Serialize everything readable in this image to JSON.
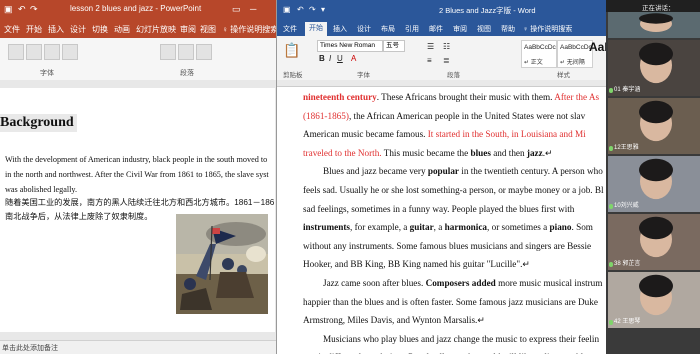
{
  "ppt": {
    "title": "lesson 2 blues and jazz - PowerPoint",
    "menu": [
      "文件",
      "开始",
      "插入",
      "设计",
      "切换",
      "动画",
      "幻灯片放映",
      "审阅",
      "视图",
      "♀ 操作说明搜索"
    ],
    "ribbon_groups": [
      "字体",
      "段落"
    ],
    "slide_heading": "Background",
    "slide_body_en": [
      "With the development of American industry, black people in the south moved to",
      "in the north and northwest. After the Civil War from 1861 to 1865, the slave syst",
      "was abolished legally."
    ],
    "slide_body_cn": [
      "随着美国工业的发展，南方的黑人陆续迁往北方和西北方城市。1861－186",
      "南北战争后，从法律上废除了奴隶制度。"
    ],
    "image_caption": "civil war painting",
    "status": "单击此处添加备注"
  },
  "word": {
    "title": "2 Blues and Jazz字版 - Word",
    "tabs": [
      "文件",
      "开始",
      "插入",
      "设计",
      "布局",
      "引用",
      "邮件",
      "审阅",
      "视图",
      "帮助",
      "♀ 操作说明搜索"
    ],
    "font_name": "Times New Roman",
    "font_size": "五号",
    "styles": [
      {
        "preview": "AaBbCcDc",
        "name": "↵ 正文"
      },
      {
        "preview": "AaBbCcDc",
        "name": "↵ 无间隔"
      }
    ],
    "style_big": "AaBl",
    "group_labels": [
      "剪贴板",
      "字体",
      "段落",
      "样式"
    ],
    "paragraphs": [
      [
        {
          "t": "nineteenth century",
          "red": true,
          "b": true
        },
        {
          "t": ". These Africans brought their music with them. "
        },
        {
          "t": "After the As",
          "red": true
        }
      ],
      [
        {
          "t": "(1861-1865)",
          "red": true
        },
        {
          "t": ", the African American people in the United States were not slav"
        }
      ],
      [
        {
          "t": "American music became famous. "
        },
        {
          "t": "It started in the South, in Louisiana and Mi",
          "red": true
        }
      ],
      [
        {
          "t": "traveled to the North.",
          "red": true
        },
        {
          "t": " This music became the "
        },
        {
          "t": "blues",
          "b": true
        },
        {
          "t": " and then "
        },
        {
          "t": "jazz",
          "b": true
        },
        {
          "t": ".↵"
        }
      ],
      [
        {
          "t": "Blues and jazz became very "
        },
        {
          "t": "popular",
          "b": true
        },
        {
          "t": " in the twentieth century. A person who"
        }
      ],
      [
        {
          "t": "feels sad. Usually he or she lost something-a person, or maybe money or a job. Bl"
        }
      ],
      [
        {
          "t": "sad feelings, sometimes in a funny way. People played the blues first with"
        }
      ],
      [
        {
          "t": "instruments",
          "b": true
        },
        {
          "t": ", for example, a "
        },
        {
          "t": "guitar",
          "b": true
        },
        {
          "t": ", a "
        },
        {
          "t": "harmonica",
          "b": true
        },
        {
          "t": ", or sometimes a "
        },
        {
          "t": "piano",
          "b": true
        },
        {
          "t": ". Som"
        }
      ],
      [
        {
          "t": "without any instruments. Some famous blues musicians and singers are Bessie"
        }
      ],
      [
        {
          "t": "Hooker, and BB King, BB King named his guitar \"Lucille\".↵"
        }
      ],
      [
        {
          "t": "Jazz came soon after blues. "
        },
        {
          "t": "Composers added",
          "b": true
        },
        {
          "t": " more music musical instrum"
        }
      ],
      [
        {
          "t": "happier than the blues and is often faster. Some famous jazz musicians are Duke"
        }
      ],
      [
        {
          "t": "Armstrong, Miles Davis, and Wynton Marsalis.↵"
        }
      ],
      [
        {
          "t": "Musicians who play blues and jazz change the music to express their feelin"
        }
      ],
      [
        {
          "t": "music differently each time. People all over the world still like to listen to blues and jazz.↵"
        }
      ]
    ],
    "indented_lines": [
      4,
      10,
      13
    ]
  },
  "video": {
    "header": "正在讲话：",
    "tiles": [
      {
        "name": "",
        "bg": "#5b6a70"
      },
      {
        "name": "01 秦宇涵",
        "bg": "#4a4440"
      },
      {
        "name": "12王思雅",
        "bg": "#6b5e50"
      },
      {
        "name": "10刘兴威",
        "bg": "#8a8f98"
      },
      {
        "name": "38 郭芷言",
        "bg": "#7a6a60"
      },
      {
        "name": "42 王思琴",
        "bg": "#b0a8a0"
      }
    ]
  }
}
